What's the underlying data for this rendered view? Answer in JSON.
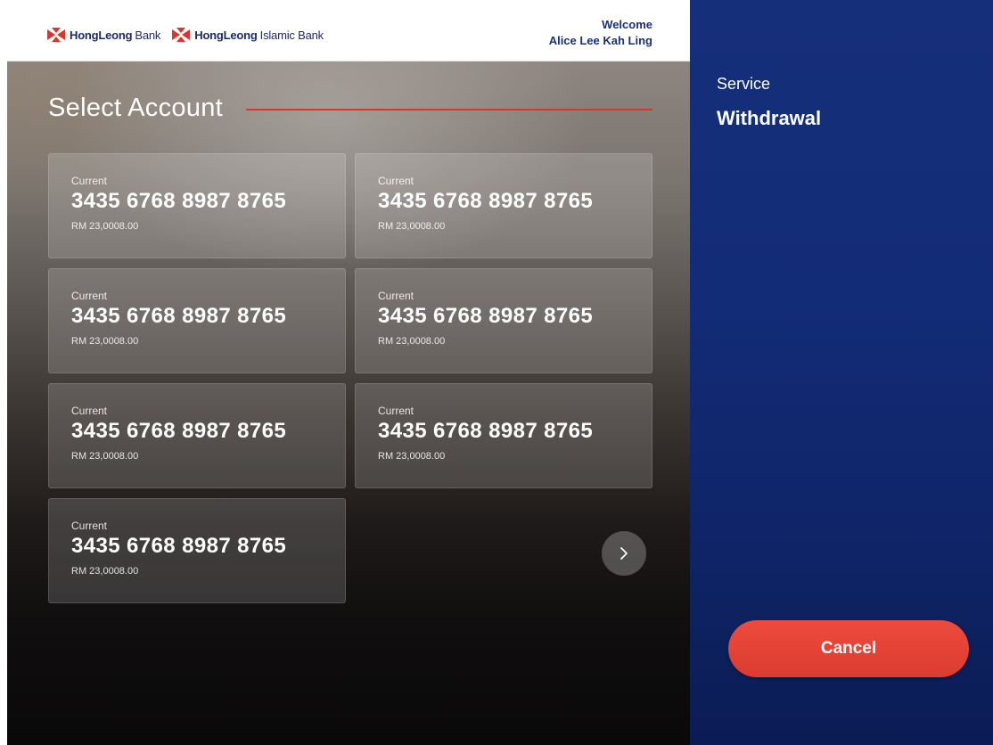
{
  "header": {
    "logos": [
      {
        "brand": "HongLeong",
        "sub": "Bank"
      },
      {
        "brand": "HongLeong",
        "sub": "Islamic Bank"
      }
    ],
    "welcome_line1": "Welcome",
    "welcome_line2": "Alice Lee Kah Ling"
  },
  "main": {
    "title": "Select Account",
    "accounts": [
      {
        "type": "Current",
        "number": "3435 6768 8987 8765",
        "balance": "RM 23,0008.00"
      },
      {
        "type": "Current",
        "number": "3435 6768 8987 8765",
        "balance": "RM 23,0008.00"
      },
      {
        "type": "Current",
        "number": "3435 6768 8987 8765",
        "balance": "RM 23,0008.00"
      },
      {
        "type": "Current",
        "number": "3435 6768 8987 8765",
        "balance": "RM 23,0008.00"
      },
      {
        "type": "Current",
        "number": "3435 6768 8987 8765",
        "balance": "RM 23,0008.00"
      },
      {
        "type": "Current",
        "number": "3435 6768 8987 8765",
        "balance": "RM 23,0008.00"
      },
      {
        "type": "Current",
        "number": "3435 6768 8987 8765",
        "balance": "RM 23,0008.00"
      }
    ],
    "next_icon": "chevron-right-icon"
  },
  "side": {
    "service_label": "Service",
    "service_value": "Withdrawal",
    "cancel_label": "Cancel"
  },
  "colors": {
    "brand_blue": "#17307a",
    "accent_red": "#e0332e",
    "panel_blue": "#132c78"
  }
}
